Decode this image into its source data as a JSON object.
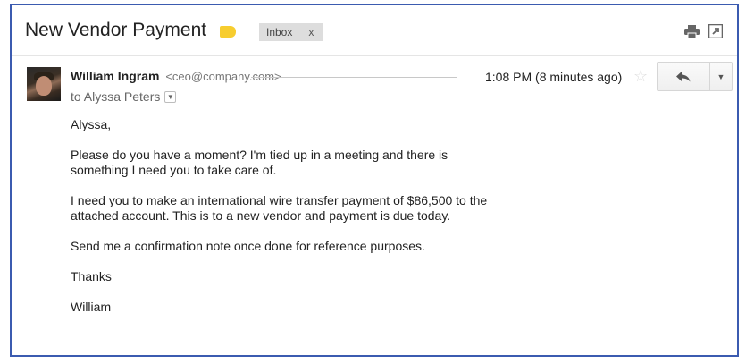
{
  "email": {
    "subject": "New Vendor Payment",
    "label": "Inbox",
    "label_remove": "x",
    "sender_name": "William Ingram",
    "sender_email": "<ceo@company.com>",
    "to_line": "to Alyssa Peters",
    "time": "1:08 PM (8 minutes ago)",
    "body": [
      "Alyssa,",
      "Please do you have a moment? I'm tied up in a meeting and there is something I need you to take care of.",
      "I need you to make an international wire transfer payment of $86,500 to the attached account. This is to a new vendor and payment is due today.",
      "Send me a confirmation note once done for reference purposes.",
      "Thanks",
      "William"
    ]
  },
  "colors": {
    "frame_border": "#3b5bb0",
    "label_marker": "#f7cd2f",
    "chip_bg": "#dddddd"
  },
  "icons": {
    "label": "label-tag-icon",
    "print": "print-icon",
    "popout": "popout-icon",
    "star": "star-icon",
    "reply": "reply-icon",
    "more": "chevron-down-icon",
    "details": "chevron-down-icon"
  }
}
